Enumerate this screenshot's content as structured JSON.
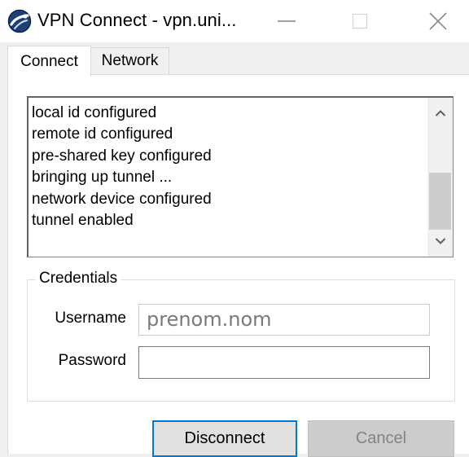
{
  "window": {
    "title": "VPN Connect - vpn.uni...",
    "icon": "vpn-globe-icon",
    "controls": [
      "minimize",
      "maximize",
      "close"
    ]
  },
  "tabs": [
    {
      "label": "Connect",
      "selected": true
    },
    {
      "label": "Network",
      "selected": false
    }
  ],
  "log": {
    "lines": [
      "local id configured",
      "remote id configured",
      "pre-shared key configured",
      "bringing up tunnel ...",
      "network device configured",
      "tunnel enabled"
    ]
  },
  "credentials": {
    "legend": "Credentials",
    "username_label": "Username",
    "username_value": "prenom.nom",
    "password_label": "Password",
    "password_value": ""
  },
  "buttons": {
    "disconnect": "Disconnect",
    "cancel": "Cancel"
  },
  "colors": {
    "accent_border": "#0078d7",
    "disabled_text": "#838383"
  }
}
